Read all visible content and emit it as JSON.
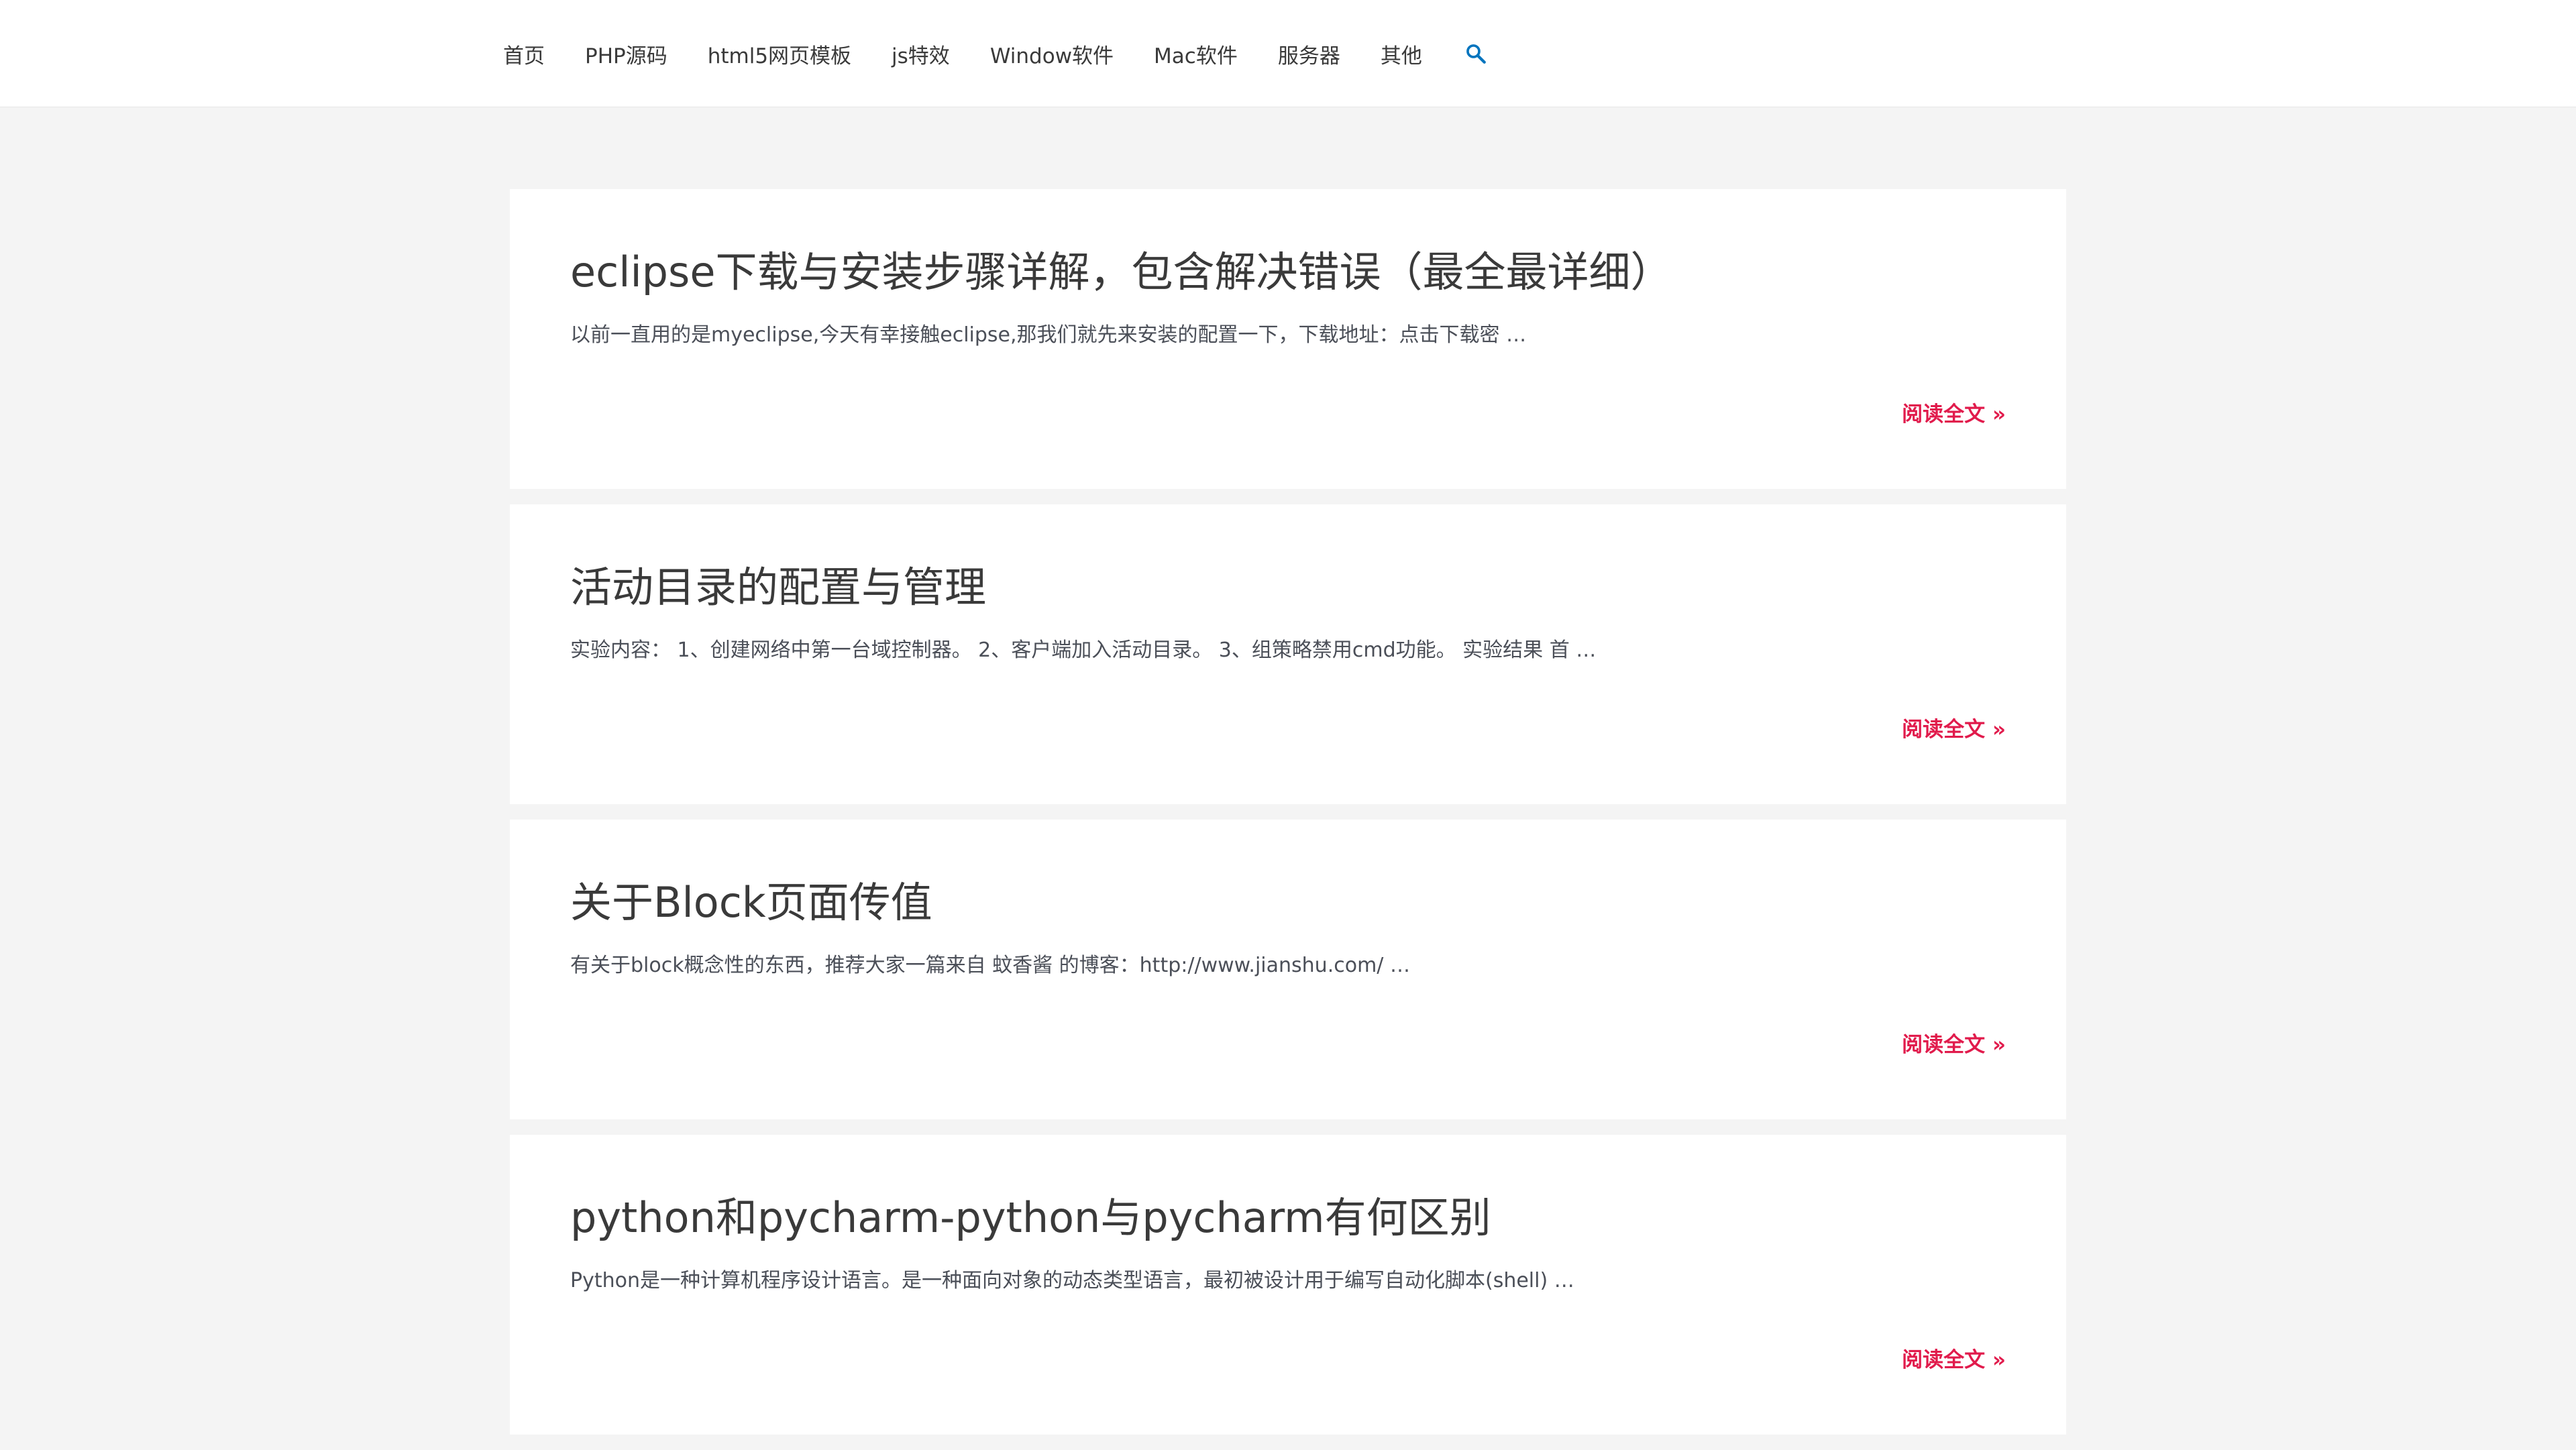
{
  "nav": {
    "items": [
      "首页",
      "PHP源码",
      "html5网页模板",
      "js特效",
      "Window软件",
      "Mac软件",
      "服务器",
      "其他"
    ],
    "search_icon": "search-icon"
  },
  "posts": [
    {
      "title": "eclipse下载与安装步骤详解，包含解决错误（最全最详细）",
      "excerpt": "以前一直用的是myeclipse,今天有幸接触eclipse,那我们就先来安装的配置一下，下载地址：点击下载密 …",
      "read_more": "阅读全文 »"
    },
    {
      "title": "活动目录的配置与管理",
      "excerpt": "实验内容： 1、创建网络中第一台域控制器。 2、客户端加入活动目录。 3、组策略禁用cmd功能。 实验结果 首 …",
      "read_more": "阅读全文 »"
    },
    {
      "title": "关于Block页面传值",
      "excerpt": "有关于block概念性的东西，推荐大家一篇来自 蚊香酱 的博客：http://www.jianshu.com/ …",
      "read_more": "阅读全文 »"
    },
    {
      "title": "python和pycharm-python与pycharm有何区别",
      "excerpt": "Python是一种计算机程序设计语言。是一种面向对象的动态类型语言，最初被设计用于编写自动化脚本(shell) …",
      "read_more": "阅读全文 »"
    }
  ],
  "colors": {
    "accent": "#e11b4c",
    "search": "#0274be",
    "text": "#3a3a3a",
    "background": "#f4f4f4"
  }
}
